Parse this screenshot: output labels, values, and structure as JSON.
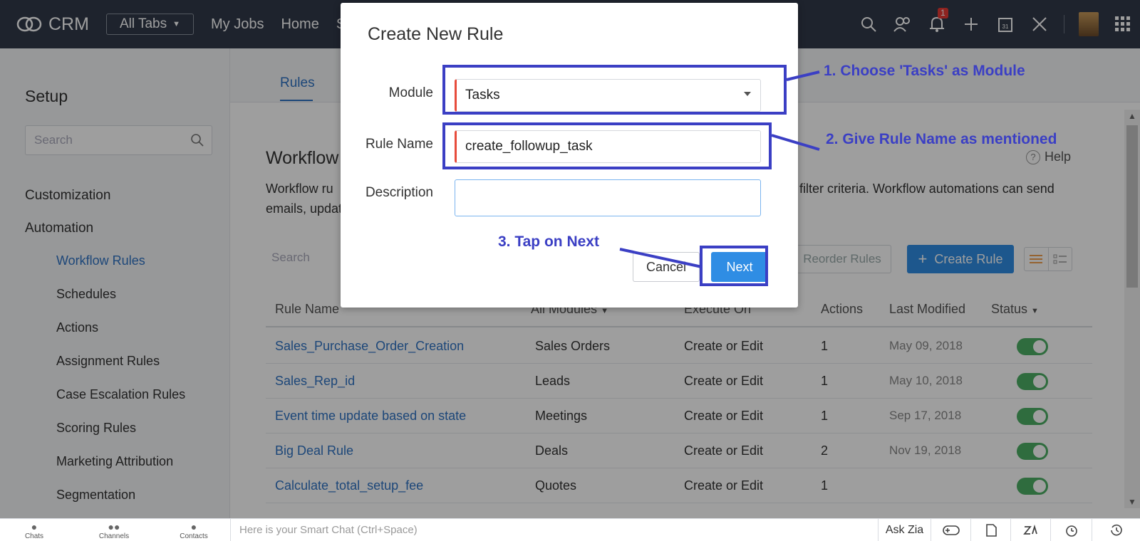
{
  "nav": {
    "brand": "CRM",
    "all_tabs": "All Tabs",
    "links": [
      "My Jobs",
      "Home",
      "S"
    ],
    "notification_count": "1",
    "calendar_day": "31"
  },
  "sidebar": {
    "title": "Setup",
    "search_placeholder": "Search",
    "categories": [
      "Customization",
      "Automation"
    ],
    "items": [
      "Workflow Rules",
      "Schedules",
      "Actions",
      "Assignment Rules",
      "Case Escalation Rules",
      "Scoring Rules",
      "Marketing Attribution",
      "Segmentation"
    ]
  },
  "main": {
    "tab": "Rules",
    "title": "Workflow",
    "help": "Help",
    "desc_line1_left": "Workflow ru",
    "desc_line1_right": "filter criteria. Workflow automations can send",
    "desc_line2": "emails, updat",
    "search_placeholder": "Search",
    "reorder_label": "Reorder Rules",
    "create_label": "Create Rule",
    "columns": [
      "Rule Name",
      "All Modules",
      "Execute On",
      "Actions",
      "Last Modified",
      "Status"
    ],
    "rows": [
      {
        "name": "Sales_Purchase_Order_Creation",
        "module": "Sales Orders",
        "execute": "Create or Edit",
        "actions": "1",
        "modified": "May 09, 2018"
      },
      {
        "name": "Sales_Rep_id",
        "module": "Leads",
        "execute": "Create or Edit",
        "actions": "1",
        "modified": "May 10, 2018"
      },
      {
        "name": "Event time update based on state",
        "module": "Meetings",
        "execute": "Create or Edit",
        "actions": "1",
        "modified": "Sep 17, 2018"
      },
      {
        "name": "Big Deal Rule",
        "module": "Deals",
        "execute": "Create or Edit",
        "actions": "2",
        "modified": "Nov 19, 2018"
      },
      {
        "name": "Calculate_total_setup_fee",
        "module": "Quotes",
        "execute": "Create or Edit",
        "actions": "1",
        "modified": ""
      }
    ]
  },
  "modal": {
    "title": "Create New Rule",
    "module_label": "Module",
    "module_value": "Tasks",
    "rule_name_label": "Rule Name",
    "rule_name_value": "create_followup_task",
    "description_label": "Description",
    "description_value": "",
    "cancel": "Cancel",
    "next": "Next"
  },
  "annotations": {
    "step1": "1. Choose 'Tasks' as Module",
    "step2": "2. Give Rule Name as mentioned",
    "step3": "3. Tap on Next"
  },
  "bottom": {
    "chats": "Chats",
    "channels": "Channels",
    "contacts": "Contacts",
    "smart_chat": "Here is your Smart Chat (Ctrl+Space)",
    "ask_zia": "Ask Zia"
  },
  "colors": {
    "nav_bg": "#313949",
    "accent": "#2f8de4",
    "link": "#2f73c4",
    "annotation": "#3b3fc4",
    "toggle_on": "#4caf64",
    "required": "#e74c3c"
  }
}
